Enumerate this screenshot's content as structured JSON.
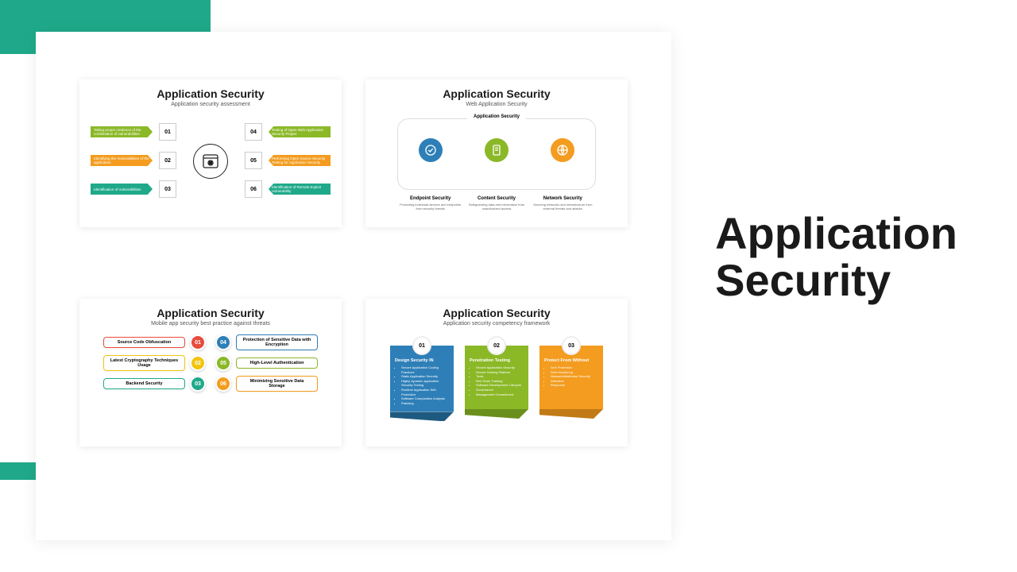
{
  "main_title": "Application\nSecurity",
  "slide1": {
    "title": "Application Security",
    "subtitle": "Application security assessment",
    "left": [
      {
        "num": "01",
        "text": "Taking proper credence of the combination of vulnerabilities",
        "color": "#8bb827"
      },
      {
        "num": "02",
        "text": "Identifying the Vulnerabilities of the application",
        "color": "#f39c1f"
      },
      {
        "num": "03",
        "text": "Identification of Vulnerabilities",
        "color": "#1fa98a"
      }
    ],
    "right": [
      {
        "num": "04",
        "text": "Testing of Open Web Application Security Project",
        "color": "#8bb827"
      },
      {
        "num": "05",
        "text": "Performing Open Source Security Testing for Application Security",
        "color": "#f39c1f"
      },
      {
        "num": "06",
        "text": "Identification of Remote Exploit Vulnerability",
        "color": "#1fa98a"
      }
    ]
  },
  "slide2": {
    "title": "Application Security",
    "subtitle": "Web Application Security",
    "frame_label": "Application Security",
    "cols": [
      {
        "title": "Endpoint Security",
        "desc": "Protecting individual devices and endpoints from security threats",
        "color": "#2e7fb8"
      },
      {
        "title": "Content Security",
        "desc": "Safeguarding data and information from unauthorized access",
        "color": "#8bb827"
      },
      {
        "title": "Network Security",
        "desc": "Securing networks and infrastructure from external threats and attacks",
        "color": "#f39c1f"
      }
    ]
  },
  "slide3": {
    "title": "Application Security",
    "subtitle": "Mobile app security best practice against threats",
    "items": [
      {
        "num": "01",
        "text": "Source Code Obfuscation",
        "color": "#e74c3c"
      },
      {
        "num": "04",
        "text": "Protection of Sensitive Data with Encryption",
        "color": "#2e7fb8"
      },
      {
        "num": "02",
        "text": "Latest Cryptography Techniques Usage",
        "color": "#f1c40f"
      },
      {
        "num": "05",
        "text": "High-Level Authentication",
        "color": "#8bb827"
      },
      {
        "num": "03",
        "text": "Backend Security",
        "color": "#1fa98a"
      },
      {
        "num": "06",
        "text": "Minimizing Sensitive Data Storage",
        "color": "#f39c1f"
      }
    ]
  },
  "slide4": {
    "title": "Application Security",
    "subtitle": "Application security  competency framework",
    "cards": [
      {
        "num": "01",
        "title": "Design Security IN",
        "items": [
          "Secure Application Coding Practices",
          "Static Application Security",
          "Highly dynamic application Security Testing",
          "Runtime Application Self-Protection",
          "Software Composition Analysis",
          "Patching"
        ],
        "color": "#2e7fb8",
        "fold": "#1e5a80"
      },
      {
        "num": "02",
        "title": "Penetration Testing",
        "items": [
          "Secure Application Security",
          "Secure Hosting Platform",
          "Tools",
          "Red Team Training",
          "Software Development Lifecycle",
          "Governance",
          "Management Commitment"
        ],
        "color": "#8bb827",
        "fold": "#6a8f1c"
      },
      {
        "num": "03",
        "title": "Protect From Without",
        "items": [
          "DoS Protection",
          "Web Monitoring",
          "Network/distributed Security",
          "Detection",
          "Response"
        ],
        "color": "#f39c1f",
        "fold": "#c17a15"
      }
    ]
  }
}
